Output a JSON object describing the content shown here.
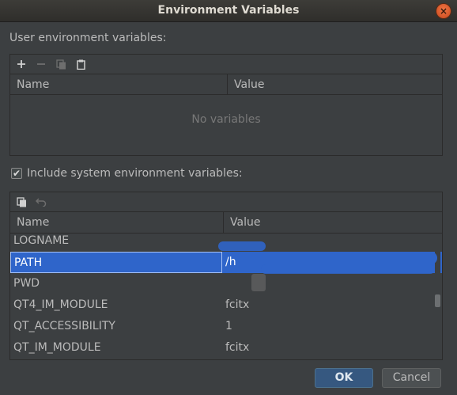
{
  "window": {
    "title": "Environment Variables",
    "close_glyph": "×"
  },
  "user_section": {
    "label": "User environment variables:",
    "toolbar": {
      "add_icon": "plus-icon",
      "remove_icon": "minus-icon",
      "copy_icon": "copy-icon",
      "paste_icon": "paste-icon"
    },
    "columns": [
      "Name",
      "Value"
    ],
    "empty_text": "No variables"
  },
  "system_section": {
    "include_label": "Include system environment variables:",
    "include_checked": true,
    "check_glyph": "✔",
    "toolbar": {
      "copy_icon": "copy-icon",
      "revert_icon": "undo-icon"
    },
    "columns": [
      "Name",
      "Value"
    ],
    "rows": [
      {
        "name": "LOGNAME",
        "value": "",
        "selected": false
      },
      {
        "name": "PATH",
        "value": "/h",
        "selected": true
      },
      {
        "name": "PWD",
        "value": "",
        "selected": false
      },
      {
        "name": "QT4_IM_MODULE",
        "value": "fcitx",
        "selected": false
      },
      {
        "name": "QT_ACCESSIBILITY",
        "value": "1",
        "selected": false
      },
      {
        "name": "QT_IM_MODULE",
        "value": "fcitx",
        "selected": false
      }
    ]
  },
  "buttons": {
    "ok": "OK",
    "cancel": "Cancel"
  },
  "colors": {
    "background": "#3c3f41",
    "selection": "#2f65ca",
    "ok_button": "#365880",
    "close_button": "#e95420"
  }
}
